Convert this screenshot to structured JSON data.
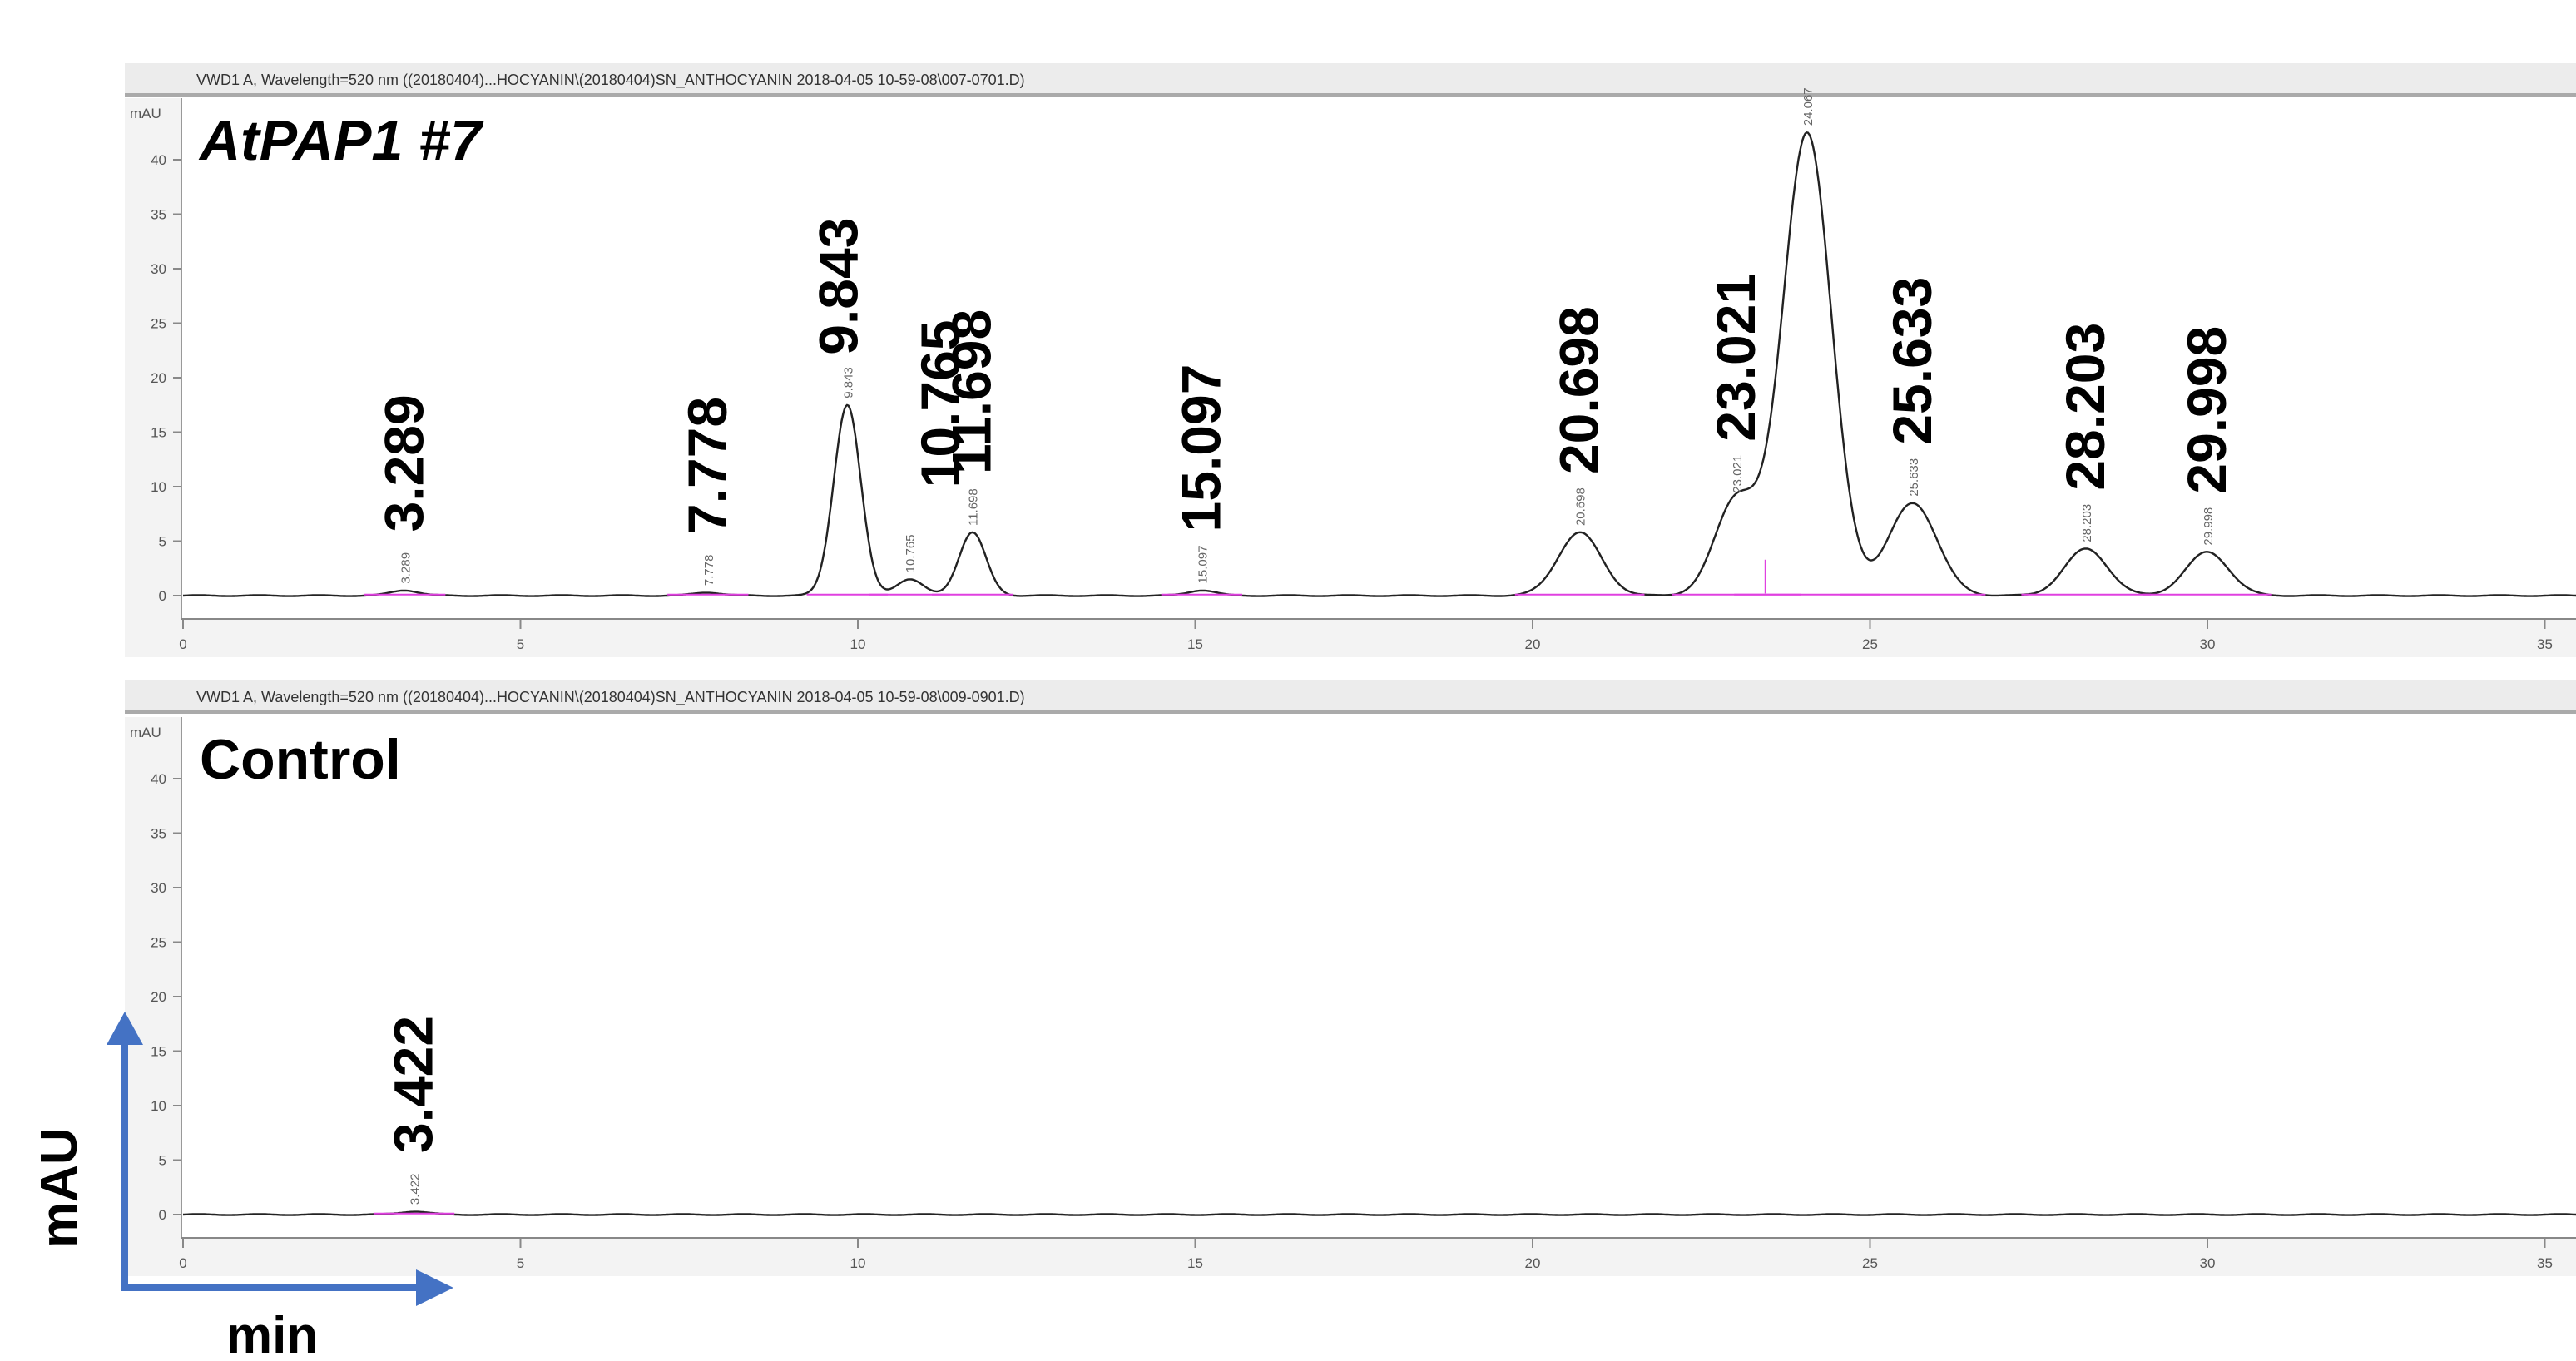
{
  "chart_data": [
    {
      "type": "line",
      "header": "VWD1 A, Wavelength=520 nm ((20180404)...HOCYANIN\\(20180404)SN_ANTHOCYANIN 2018-04-05 10-59-08\\007-0701.D)",
      "title": "AtPAP1 #7",
      "y_unit_label": "mAU",
      "xlim": [
        0,
        35.5
      ],
      "ylim": [
        -3,
        44
      ],
      "x_ticks": [
        "0",
        "5",
        "10",
        "15",
        "20",
        "25",
        "30",
        "35"
      ],
      "y_ticks": [
        "0",
        "5",
        "10",
        "15",
        "20",
        "25",
        "30",
        "35",
        "40"
      ],
      "peaks": [
        {
          "rt": "3.289",
          "height": 0.5
        },
        {
          "rt": "7.778",
          "height": 0.3
        },
        {
          "rt": "9.843",
          "height": 17.5
        },
        {
          "rt": "10.765",
          "height": 1.5
        },
        {
          "rt": "11.698",
          "height": 5.8
        },
        {
          "rt": "15.097",
          "height": 0.5
        },
        {
          "rt": "20.698",
          "height": 5.8
        },
        {
          "rt": "23.021",
          "height": 8.8
        },
        {
          "rt": "24.067",
          "height": 42.5
        },
        {
          "rt": "25.633",
          "height": 8.5
        },
        {
          "rt": "28.203",
          "height": 4.3
        },
        {
          "rt": "29.998",
          "height": 4.0
        }
      ]
    },
    {
      "type": "line",
      "header": "VWD1 A, Wavelength=520 nm ((20180404)...HOCYANIN\\(20180404)SN_ANTHOCYANIN 2018-04-05 10-59-08\\009-0901.D)",
      "title": "Control",
      "y_unit_label": "mAU",
      "xlim": [
        0,
        35.5
      ],
      "ylim": [
        -3,
        44
      ],
      "x_ticks": [
        "0",
        "5",
        "10",
        "15",
        "20",
        "25",
        "30",
        "35"
      ],
      "y_ticks": [
        "0",
        "5",
        "10",
        "15",
        "20",
        "25",
        "30",
        "35",
        "40"
      ],
      "peaks": [
        {
          "rt": "3.422",
          "height": 0.3
        }
      ]
    }
  ],
  "axes_annotation": {
    "y_label": "mAU",
    "x_label": "min",
    "arrow_color": "#4472C4"
  },
  "colors": {
    "trace": "#222222",
    "baseline": "#E040E0",
    "axis_arrow": "#4472C4"
  }
}
